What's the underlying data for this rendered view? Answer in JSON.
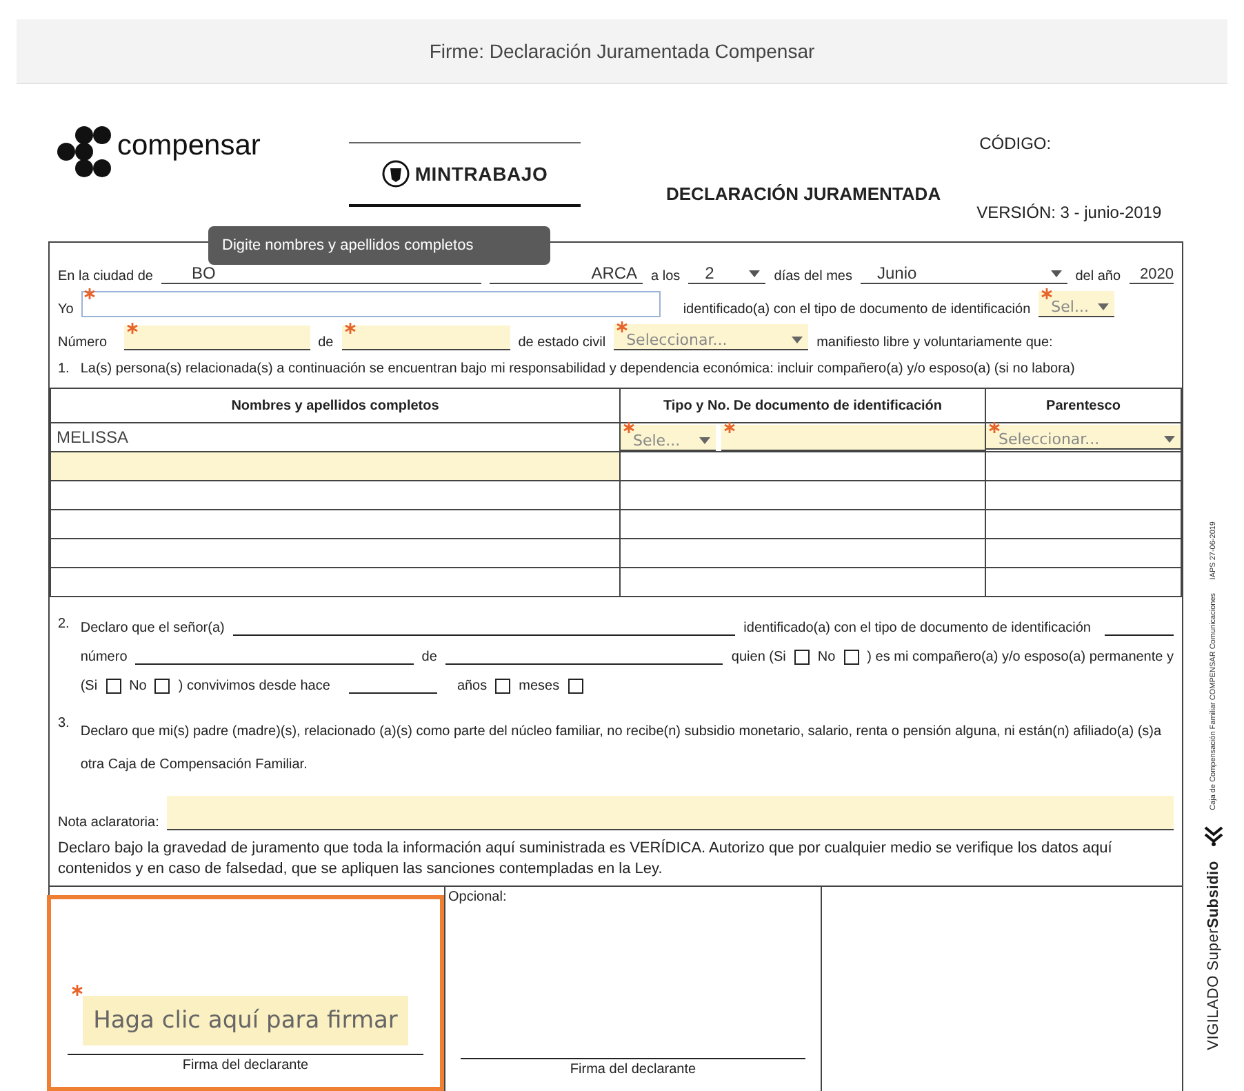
{
  "header": {
    "title": "Firme: Declaración Juramentada Compensar"
  },
  "brand": {
    "name": "compensar",
    "ministry": "MINTRABAJO"
  },
  "document": {
    "title": "DECLARACIÓN JURAMENTADA",
    "code_label": "CÓDIGO:",
    "version": "VERSIÓN: 3 - junio-2019"
  },
  "tooltip": {
    "text": "Digite nombres y apellidos completos"
  },
  "place_date": {
    "city_label": "En la ciudad de",
    "city": "BO",
    "department": "ARCA",
    "day_label": "a los",
    "day": "2",
    "month_label": "días del mes",
    "month": "Junio",
    "year_label": "del año",
    "year": "2020"
  },
  "identity": {
    "yo_label": "Yo",
    "name_field": {
      "required": true,
      "focused": true
    },
    "id_type_label": "identificado(a) con el tipo de documento de identificación",
    "id_type": {
      "placeholder": "Sel...",
      "required": true
    },
    "number_label": "Número",
    "number_field": {
      "required": true
    },
    "from_label": "de",
    "from_field": {
      "required": true
    },
    "civil_label": "de estado civil",
    "civil_status": {
      "placeholder": "Seleccionar...",
      "required": true
    },
    "closing": "manifiesto libre y voluntariamente que:"
  },
  "item_1": {
    "number": "1.",
    "text": "La(s) persona(s) relacionada(s) a continuación se encuentran bajo mi responsabilidad y dependencia económica: incluir compañero(a) y/o esposo(a) (si no labora)"
  },
  "dependents_table": {
    "columns": [
      "Nombres y apellidos completos",
      "Tipo y No. De documento de identificación",
      "Parentesco"
    ],
    "rows": [
      {
        "kind": "entry",
        "name": "MELISSA",
        "doc_type": {
          "placeholder": "Sele...",
          "required": true
        },
        "doc_number": {
          "required": true
        },
        "relation": {
          "placeholder": "Seleccionar...",
          "required": true
        }
      },
      {
        "kind": "blank",
        "highlighted": true
      },
      {
        "kind": "blank",
        "highlighted": false
      },
      {
        "kind": "blank",
        "highlighted": false
      },
      {
        "kind": "blank",
        "highlighted": false
      },
      {
        "kind": "blank",
        "highlighted": false
      }
    ]
  },
  "item_2": {
    "number": "2.",
    "lines": [
      [
        {
          "kind": "text",
          "text": "Declaro que el señor(a)"
        },
        {
          "kind": "blank"
        },
        {
          "kind": "text",
          "text": "identificado(a) con el tipo de documento de identificación"
        },
        {
          "kind": "short_blank"
        }
      ],
      [
        {
          "kind": "text",
          "text": "número"
        },
        {
          "kind": "blank"
        },
        {
          "kind": "text",
          "text": "de"
        },
        {
          "kind": "blank"
        },
        {
          "kind": "text",
          "text": "quien (Si"
        },
        {
          "kind": "checkbox",
          "checked": false
        },
        {
          "kind": "text",
          "text": "No"
        },
        {
          "kind": "checkbox",
          "checked": false
        },
        {
          "kind": "text",
          "text": ") es mi compañero(a) y/o esposo(a) permanente y"
        }
      ],
      [
        {
          "kind": "text",
          "text": "(Si"
        },
        {
          "kind": "checkbox",
          "checked": false
        },
        {
          "kind": "text",
          "text": "No"
        },
        {
          "kind": "checkbox",
          "checked": false
        },
        {
          "kind": "text",
          "text": ") convivimos desde hace"
        },
        {
          "kind": "short_blank"
        },
        {
          "kind": "text",
          "text": "años"
        },
        {
          "kind": "checkbox",
          "checked": false
        },
        {
          "kind": "text",
          "text": "meses"
        },
        {
          "kind": "checkbox",
          "checked": false
        }
      ]
    ]
  },
  "item_3": {
    "number": "3.",
    "text": "Declaro que mi(s) padre (madre)(s), relacionado (a)(s) como parte del núcleo familiar, no recibe(n) subsidio monetario, salario, renta o pensión alguna, ni están(n) afiliado(a) (s)a otra Caja de Compensación Familiar."
  },
  "note": {
    "label": "Nota aclaratoria:"
  },
  "declaration": "Declaro bajo la gravedad de juramento que toda la información aquí suministrada es VERÍDICA.  Autorizo que por cualquier medio se verifique los datos aquí contenidos y en caso de falsedad, que se apliquen las sanciones contempladas en la Ley.",
  "signatures": [
    {
      "kind": "sign_field",
      "placeholder": "Haga clic aquí para firmar",
      "required": true,
      "selected": true,
      "caption": "Firma del declarante"
    },
    {
      "kind": "optional",
      "label": "Opcional:",
      "caption": "Firma del declarante",
      "selected": false
    }
  ],
  "side_marks": {
    "vigilado": "VIGILADO Super**Subsidio**",
    "fine_print": [
      "Caja de Compensación Familiar COMPENSAR Comunicaciones",
      "IAPS 27-06-2019"
    ]
  }
}
